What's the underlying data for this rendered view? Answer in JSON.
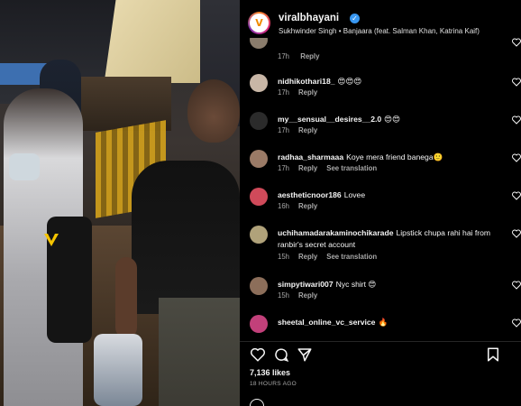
{
  "post": {
    "username": "viralbhayani",
    "avatar_initial": "V",
    "audio": "Sukhwinder Singh • Banjaara (feat. Salman Khan, Katrina Kaif)"
  },
  "partial_comment": {
    "time": "17h",
    "reply": "Reply"
  },
  "comments": [
    {
      "user": "nidhikothari18_",
      "text": "😍😍😍",
      "time": "17h",
      "reply": "Reply",
      "see_translation": "",
      "avatar_color": "#c8b6a6"
    },
    {
      "user": "my__sensual__desires__2.0",
      "text": "😍😍",
      "time": "17h",
      "reply": "Reply",
      "see_translation": "",
      "avatar_color": "#2b2b2b"
    },
    {
      "user": "radhaa_sharmaaa",
      "text": "Koye mera friend banega🙂",
      "time": "17h",
      "reply": "Reply",
      "see_translation": "See translation",
      "avatar_color": "#9a7a66"
    },
    {
      "user": "aestheticnoor186",
      "text": "Lovee",
      "time": "16h",
      "reply": "Reply",
      "see_translation": "",
      "avatar_color": "#d04a5a"
    },
    {
      "user": "uchihamadarakaminochikarade",
      "text": "Lipstick chupa rahi hai from ranbir's secret account",
      "time": "15h",
      "reply": "Reply",
      "see_translation": "See translation",
      "avatar_color": "#b0a27a"
    },
    {
      "user": "simpytiwari007",
      "text": "Nyc shirt 😍",
      "time": "15h",
      "reply": "Reply",
      "see_translation": "",
      "avatar_color": "#8c6e5a"
    },
    {
      "user": "sheetal_online_vc_service",
      "text": "🔥",
      "time": "",
      "reply": "",
      "see_translation": "",
      "avatar_color": "#c2407a"
    }
  ],
  "footer": {
    "likes": "7,136 likes",
    "time_ago": "18 HOURS AGO"
  },
  "icons": {
    "like": "heart-icon",
    "comment": "comment-icon",
    "share": "send-icon",
    "save": "bookmark-icon",
    "verified": "verified-badge-icon"
  },
  "colors": {
    "background": "#000000",
    "text": "#f5f5f5",
    "muted": "#a8a8a8",
    "verified": "#3897f0",
    "logo": "#f6c400"
  }
}
